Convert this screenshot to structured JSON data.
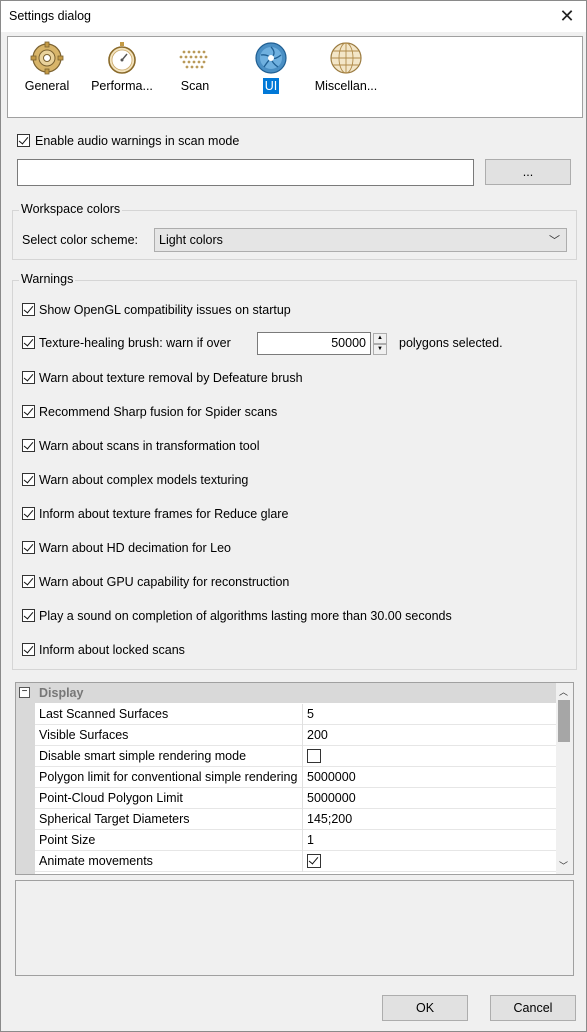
{
  "window": {
    "title": "Settings dialog"
  },
  "toolbar": {
    "tabs": [
      {
        "label": "General",
        "icon": "gear-icon"
      },
      {
        "label": "Performa...",
        "icon": "stopwatch-icon"
      },
      {
        "label": "Scan",
        "icon": "dot-matrix-icon"
      },
      {
        "label": "UI",
        "icon": "aperture-icon",
        "active": true
      },
      {
        "label": "Miscellan...",
        "icon": "globe-icon"
      }
    ]
  },
  "audio": {
    "label": "Enable audio warnings in scan mode",
    "checked": true,
    "path_value": "",
    "browse_label": "..."
  },
  "workspace": {
    "legend": "Workspace colors",
    "scheme_label": "Select color scheme:",
    "scheme_value": "Light colors"
  },
  "warnings": {
    "legend": "Warnings",
    "opengl": "Show OpenGL compatibility issues on startup",
    "texture_brush_prefix": "Texture-healing brush: warn if over",
    "texture_brush_value": "50000",
    "texture_brush_suffix": "polygons selected.",
    "items": [
      "Warn about texture removal by Defeature brush",
      "Recommend Sharp fusion for Spider scans",
      "Warn about scans in transformation tool",
      "Warn about complex models texturing",
      "Inform about texture frames for Reduce glare",
      "Warn about HD decimation for Leo",
      "Warn about GPU capability for reconstruction",
      "Play a sound on completion of algorithms lasting more than 30.00 seconds",
      "Inform about locked scans"
    ]
  },
  "grid": {
    "category": "Display",
    "rows": [
      {
        "key": "Last Scanned Surfaces",
        "value": "5"
      },
      {
        "key": "Visible Surfaces",
        "value": "200"
      },
      {
        "key": "Disable smart simple rendering mode",
        "checkbox": false
      },
      {
        "key": "Polygon limit for conventional simple rendering",
        "value": "5000000"
      },
      {
        "key": "Point-Cloud Polygon Limit",
        "value": "5000000"
      },
      {
        "key": "Spherical Target Diameters",
        "value": "145;200"
      },
      {
        "key": "Point Size",
        "value": "1"
      },
      {
        "key": "Animate movements",
        "checkbox": true
      }
    ]
  },
  "buttons": {
    "ok": "OK",
    "cancel": "Cancel"
  },
  "colors": {
    "accent": "#0078d7",
    "background": "#f0f0f0"
  }
}
